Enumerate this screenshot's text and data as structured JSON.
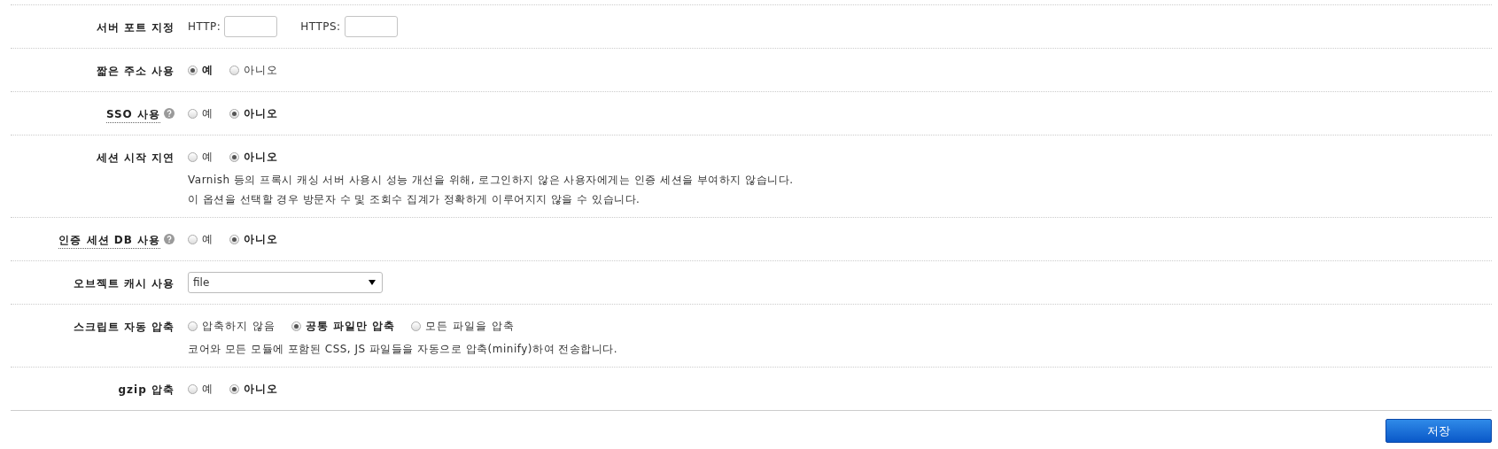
{
  "rows": [
    {
      "label": "서버 포트 지정",
      "help": false,
      "kind": "ports",
      "fields": [
        {
          "label": "HTTP:"
        },
        {
          "label": "HTTPS:"
        }
      ]
    },
    {
      "label": "짧은 주소 사용",
      "help": false,
      "kind": "radio",
      "options": [
        {
          "label": "예",
          "selected": true
        },
        {
          "label": "아니오",
          "selected": false
        }
      ]
    },
    {
      "label": "SSO 사용",
      "help": true,
      "kind": "radio",
      "options": [
        {
          "label": "예",
          "selected": false
        },
        {
          "label": "아니오",
          "selected": true
        }
      ]
    },
    {
      "label": "세션 시작 지연",
      "help": false,
      "kind": "radio",
      "options": [
        {
          "label": "예",
          "selected": false
        },
        {
          "label": "아니오",
          "selected": true
        }
      ],
      "description": [
        "Varnish 등의 프록시 캐싱 서버 사용시 성능 개선을 위해, 로그인하지 않은 사용자에게는 인증 세션을 부여하지 않습니다.",
        "이 옵션을 선택할 경우 방문자 수 및 조회수 집계가 정확하게 이루어지지 않을 수 있습니다."
      ]
    },
    {
      "label": "인증 세션 DB 사용",
      "help": true,
      "kind": "radio",
      "options": [
        {
          "label": "예",
          "selected": false
        },
        {
          "label": "아니오",
          "selected": true
        }
      ]
    },
    {
      "label": "오브젝트 캐시 사용",
      "help": false,
      "kind": "select",
      "value": "file"
    },
    {
      "label": "스크립트 자동 압축",
      "help": false,
      "kind": "radio",
      "options": [
        {
          "label": "압축하지 않음",
          "selected": false
        },
        {
          "label": "공통 파일만 압축",
          "selected": true
        },
        {
          "label": "모든 파일을 압축",
          "selected": false
        }
      ],
      "description": [
        "코어와 모든 모듈에 포함된 CSS, JS 파일들을 자동으로 압축(minify)하여 전송합니다."
      ]
    },
    {
      "label": "gzip 압축",
      "help": false,
      "kind": "radio",
      "options": [
        {
          "label": "예",
          "selected": false
        },
        {
          "label": "아니오",
          "selected": true
        }
      ]
    }
  ],
  "save_button": "저장"
}
